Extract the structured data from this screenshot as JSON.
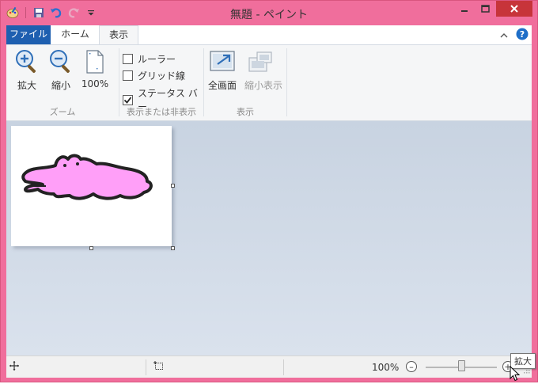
{
  "window": {
    "title": "無題 - ペイント",
    "frame_color": "#f06e9c",
    "close_color": "#c7343a"
  },
  "tabs": {
    "file": "ファイル",
    "home": "ホーム",
    "view": "表示",
    "file_color": "#1e5fb0"
  },
  "zoom_group": {
    "zoom_in": "拡大",
    "zoom_out": "縮小",
    "actual": "100%",
    "label": "ズーム"
  },
  "showhide_group": {
    "ruler": "ルーラー",
    "gridlines": "グリッド線",
    "statusbar": "ステータス バー",
    "label": "表示または非表示",
    "ruler_checked": false,
    "grid_checked": false,
    "status_checked": true
  },
  "display_group": {
    "fullscreen": "全画面",
    "thumbnail": "縮小表示",
    "label": "表示"
  },
  "statusbar": {
    "zoom": "100%",
    "zoom_level_fraction": 0.5
  },
  "tooltip": {
    "text": "拡大"
  },
  "drawing": {
    "fill": "#ff9ff8",
    "outline": "#222222"
  }
}
